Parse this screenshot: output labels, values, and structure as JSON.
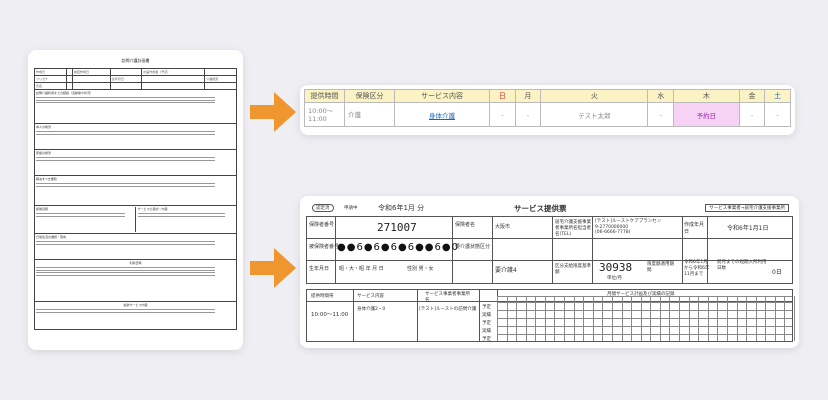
{
  "left_doc": {
    "title": "訪問介護計画書",
    "rows": [
      [
        "作成日",
        "",
        "前回作成日",
        "",
        "計画作成者（予定）",
        ""
      ],
      [
        "フリガナ",
        "",
        "",
        "生年月日",
        "",
        "介護認定"
      ],
      [
        "氏名",
        "",
        "",
        "",
        "",
        ""
      ]
    ],
    "sections": [
      "訪問介護利用までの経緯（活動等や状況）",
      "本人の希望",
      "家族の希望",
      "解決すべき課題",
      "援助目標",
      "サービスの目的・内容",
      "日常生活の課題・意向",
      "利用日時",
      "提供サービス内容"
    ]
  },
  "schedule": {
    "headers": [
      "提供時間",
      "保険区分",
      "サービス内容",
      "日",
      "月",
      "火",
      "水",
      "木",
      "金",
      "土"
    ],
    "row": {
      "time": "10:00～\n11:00",
      "insurance": "介護",
      "service": "身体介護",
      "sun": "-",
      "mon": "-",
      "tue": "テスト太郎",
      "wed": "-",
      "thu": "予約日",
      "fri": "-",
      "sat": "-"
    }
  },
  "service_sheet": {
    "stamp": "認定済",
    "sub": "申請中",
    "date": "令和6年1月 分",
    "title": "サービス提供票",
    "office_label": "サービス事業者→居宅介護支援事業所",
    "insurer_label": "保険者番号",
    "insurer_no": "271007",
    "insured_label": "被保険者番号",
    "insured_dots": "●●6●6●6●6●●6●0",
    "name_label": "保険者名",
    "city": "大阪市",
    "care_office": "居宅介護支援事業者事業所名担当者名(TEL)",
    "care_office_val": "[テスト]ルーストケアプランセン\n9-2770000000\n(06-6666-7778)",
    "created_label": "作成年月日",
    "created_val": "令和6年1月1日",
    "birth_label": "生年月日",
    "birth_val": "昭・大・昭 年 月 日",
    "gender_label": "性別 男・女",
    "care_level_label": "要介護状態区分",
    "care_level": "要介護4",
    "limit_label": "区分支給限度基準額",
    "limit_val": "30938",
    "unit": "単位/月",
    "period_label": "限度額適用期間",
    "period_val": "令和6年1月から令和6年11月まで",
    "prev_label": "前月までの短期入所利用日数",
    "prev_val": "0日",
    "lower_headers": [
      "提供時間帯",
      "サービス内容",
      "サービス事業者事業所名",
      "月間サービス計画及び実績の記録"
    ],
    "time_val": "10:00～11:00",
    "service_val": "身体介護2・0",
    "provider_val": "[テスト]ルーストの訪問介護",
    "row_labels": [
      "予定",
      "実績",
      "予定",
      "実績",
      "予定",
      "実績"
    ]
  }
}
